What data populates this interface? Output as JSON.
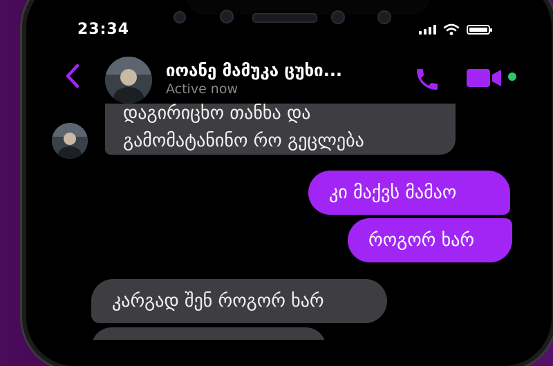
{
  "status_bar": {
    "time": "23:34",
    "battery_level": 0.85
  },
  "header": {
    "contact_name": "იოანე მამუკა ცუხი...",
    "presence": "Active now",
    "icons": [
      "back-chevron-icon",
      "avatar",
      "phone-icon",
      "video-camera-icon"
    ],
    "accent_color": "#a126f5"
  },
  "messages": [
    {
      "direction": "incoming",
      "lines": [
        "დაგირიცხო თანხა და",
        "გამომატანინო რო გეცლება"
      ]
    },
    {
      "direction": "outgoing",
      "text": "კი მაქვს მამაო"
    },
    {
      "direction": "outgoing",
      "text": "როგორ ხარ"
    },
    {
      "direction": "incoming",
      "text": "კარგად შენ როგორ ხარ"
    }
  ],
  "colors": {
    "incoming_bubble": "#3e3e42",
    "outgoing_bubble": "#a126f5",
    "background": "#000000"
  }
}
